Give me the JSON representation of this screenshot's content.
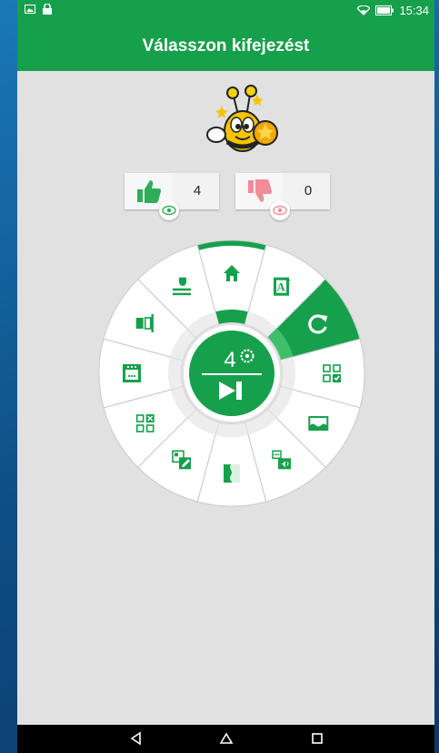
{
  "status": {
    "time": "15:34",
    "left_icons": [
      "image-icon",
      "lock-icon"
    ],
    "right_icons": [
      "wifi-icon",
      "battery-icon"
    ]
  },
  "appbar": {
    "title": "Válasszon kifejezést"
  },
  "mascot": {
    "icon": "bee-mascot-icon"
  },
  "counters": {
    "likes": "4",
    "dislikes": "0"
  },
  "wheel": {
    "center_count": "4",
    "center_icons": [
      "flower-gear-icon",
      "skip-next-icon"
    ],
    "segments": [
      "home-icon",
      "dictionary-icon",
      "refresh-icon",
      "grid-check-icon",
      "image-frame-icon",
      "speech-sound-icon",
      "column-half-icon",
      "edit-card-icon",
      "grid-remove-icon",
      "dots-panel-icon",
      "split-icon",
      "stamp-icon"
    ],
    "active_segments": [
      "home-icon",
      "refresh-icon"
    ]
  },
  "colors": {
    "primary": "#16a04c",
    "accent_light": "#3fbf6a",
    "like": "#2fae57",
    "dislike": "#f28b98",
    "background": "#e1e1e1"
  },
  "navbar": {
    "buttons": [
      "back-icon",
      "home-nav-icon",
      "recents-icon"
    ]
  }
}
